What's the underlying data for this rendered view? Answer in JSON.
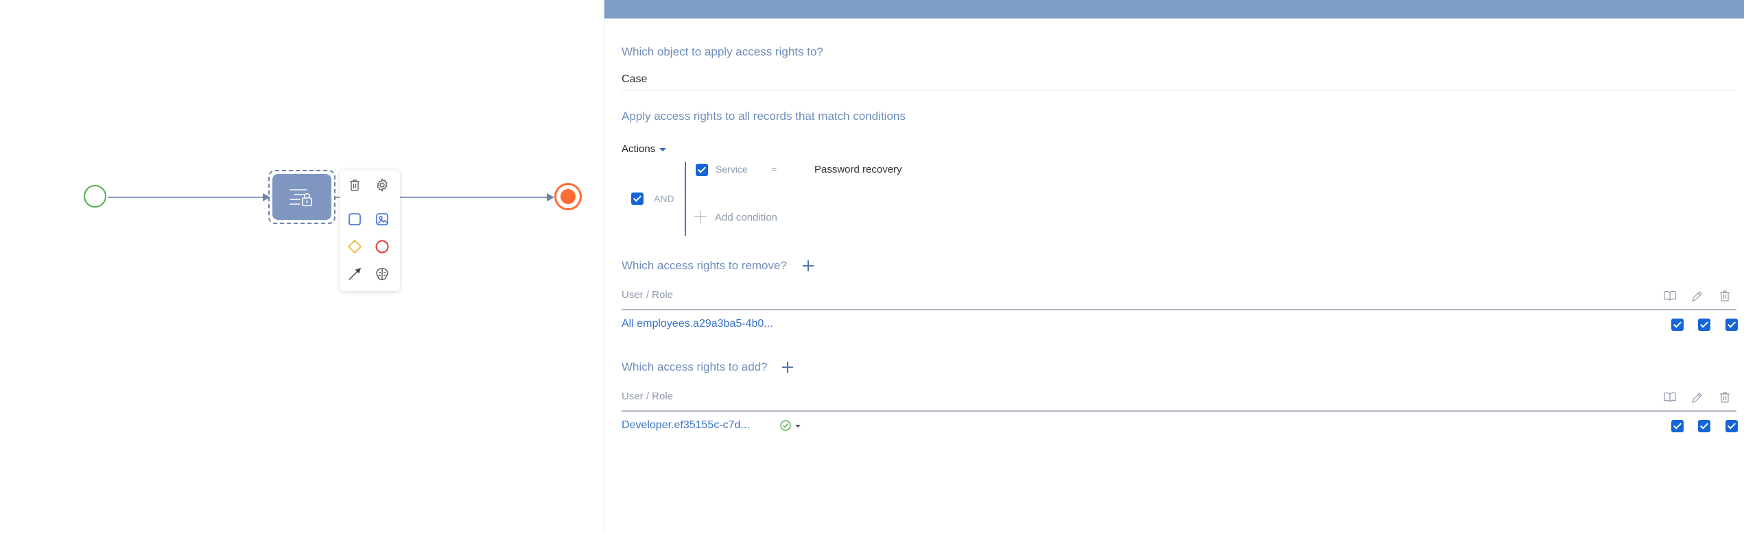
{
  "canvas": {
    "elements": {
      "start_event": "start-event",
      "task": "access-rights-task",
      "end_event": "end-event"
    },
    "palette": {
      "icons": [
        "trash-icon",
        "gear-icon",
        "task-shape-icon",
        "image-task-icon",
        "gateway-diamond-icon",
        "end-event-circle-icon",
        "connector-arrow-icon",
        "brain-ai-icon"
      ]
    },
    "colors": {
      "start": "#4caf50",
      "end": "#ff6b35",
      "task": "#7f97c0",
      "gateway": "#f0b429",
      "end_palette": "#e53935"
    }
  },
  "panel": {
    "object_question": "Which object to apply access rights to?",
    "object_value": "Case",
    "conditions_title": "Apply access rights to all records that match conditions",
    "actions_label": "Actions",
    "group_operator": "AND",
    "condition": {
      "column": "Service",
      "operator": "=",
      "value": "Password recovery"
    },
    "add_condition_label": "Add condition",
    "remove_section": {
      "title": "Which access rights to remove?",
      "column_header": "User / Role",
      "rows": [
        {
          "name": "All employees.a29a3ba5-4b0..."
        }
      ]
    },
    "add_section": {
      "title": "Which access rights to add?",
      "column_header": "User / Role",
      "rows": [
        {
          "name": "Developer.ef35155c-c7d..."
        }
      ]
    },
    "rights_icons": [
      "read-book-icon",
      "edit-pencil-icon",
      "delete-trash-icon"
    ],
    "colors": {
      "header_bar": "#7f9cc4",
      "section_title": "#6f8dbb",
      "checkbox": "#1565d8",
      "link": "#3a74c4",
      "status_ok": "#4caf50"
    }
  }
}
